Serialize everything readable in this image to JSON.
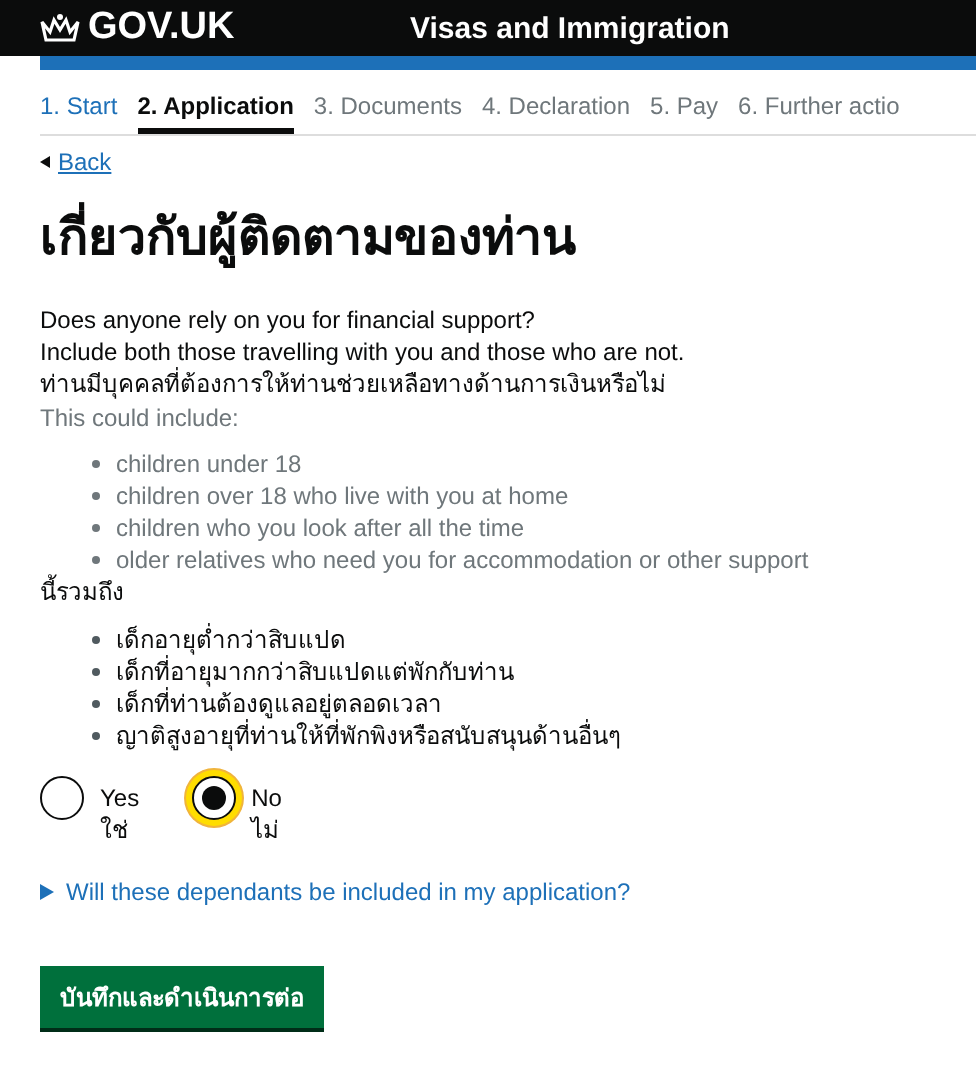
{
  "header": {
    "logo": "GOV.UK",
    "service": "Visas and Immigration"
  },
  "steps": [
    {
      "label": "1. Start",
      "selected": false,
      "completed": true
    },
    {
      "label": "2. Application",
      "selected": true,
      "completed": false
    },
    {
      "label": "3. Documents",
      "selected": false,
      "completed": false
    },
    {
      "label": "4. Declaration",
      "selected": false,
      "completed": false
    },
    {
      "label": "5. Pay",
      "selected": false,
      "completed": false
    },
    {
      "label": "6. Further actio",
      "selected": false,
      "completed": false
    }
  ],
  "back_link": "Back",
  "heading": "เกี่ยวกับผู้ติดตามของท่าน",
  "question": [
    "Does anyone rely on you for financial support?",
    "Include both those travelling with you and those who are not.",
    "ท่านมีบุคคลที่ต้องการให้ท่านช่วยเหลือทางด้านการเงินหรือไม่"
  ],
  "hint": "This could include:",
  "hint_items": [
    "children under 18",
    "children over 18 who live with you at home",
    "children who you look after all the time",
    "older relatives who need you for accommodation or other support"
  ],
  "thai_hint": "นี้รวมถึง",
  "thai_items": [
    "เด็กอายุต่ำกว่าสิบแปด",
    "เด็กที่อายุมากกว่าสิบแปดแต่พักกับท่าน",
    "เด็กที่ท่านต้องดูแลอยู่ตลอดเวลา",
    "ญาติสูงอายุที่ท่านให้ที่พักพิงหรือสนับสนุนด้านอื่นๆ"
  ],
  "radios": [
    {
      "label": "Yes",
      "label_thai": "ใช่",
      "selected": false,
      "focused": false
    },
    {
      "label": "No",
      "label_thai": "ไม่",
      "selected": true,
      "focused": true
    }
  ],
  "details": {
    "summary": "Will these dependants be included in my application?",
    "expanded": false
  },
  "submit_button": "บันทึกและดำเนินการต่อ"
}
